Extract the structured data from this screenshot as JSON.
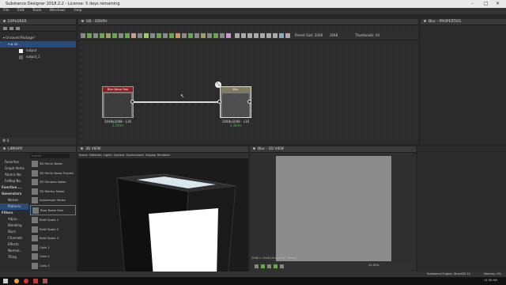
{
  "window": {
    "title": "Substance Designer 2018.2.2 - License: 5 days remaining",
    "controls": [
      "–",
      "□",
      "✕"
    ]
  },
  "menu": [
    "File",
    "Edit",
    "Tools",
    "Windows",
    "Help"
  ],
  "explorer": {
    "title": "EXPLORER",
    "package": "Unsaved Package*",
    "items": [
      "ub",
      "output",
      "output_1"
    ]
  },
  "graph": {
    "title": "UB - GRAPH",
    "parent_size_label": "Parent Size: 2048",
    "size_b": "2048",
    "thumbnails_label": "Thumbnails: All",
    "nodes": [
      {
        "name": "Blue Noise Fast",
        "size": "2048x2048 - L16",
        "time": "3.24ms"
      },
      {
        "name": "Blur",
        "size": "2048x2048 - L16",
        "time": "3.38ms"
      }
    ]
  },
  "properties": {
    "title": "Blur - PROPERTIES"
  },
  "library": {
    "title": "LIBRARY",
    "search_placeholder": "Search",
    "categories": [
      "Favorites",
      "Graph Items",
      "Atomic No.",
      "FxMap No.",
      "Function ...",
      "Generators",
      "Noises",
      "Patterns",
      "Filters",
      "Adjus...",
      "Blending",
      "Blurs",
      "Channels",
      "Effects",
      "Normal...",
      "Tiling"
    ],
    "items": [
      "3D Perlin Noise",
      "3D Perlin Noise Fractal",
      "3D Simplex Noise",
      "3D Worley Noise",
      "Anisotropic Noise",
      "Blue Noise Fast",
      "BnW Spots 1",
      "BnW Spots 2",
      "BnW Spots 3",
      "Cells 1",
      "Cells 2",
      "Cells 3"
    ]
  },
  "view3d": {
    "title": "3D VIEW",
    "menu": [
      "Scene",
      "Materials",
      "Lights",
      "Camera",
      "Environment",
      "Display",
      "Renderer"
    ]
  },
  "view2d": {
    "title": "Blur - 2D VIEW",
    "info": "2048 × 2048 (Grayscale, 16bpc)",
    "zoom": "31.92%"
  },
  "status": {
    "engine": "Substance Engine: Direct3D 10",
    "memory": "Memory: 0%"
  },
  "taskbar": {
    "time": "12:36 AM"
  }
}
